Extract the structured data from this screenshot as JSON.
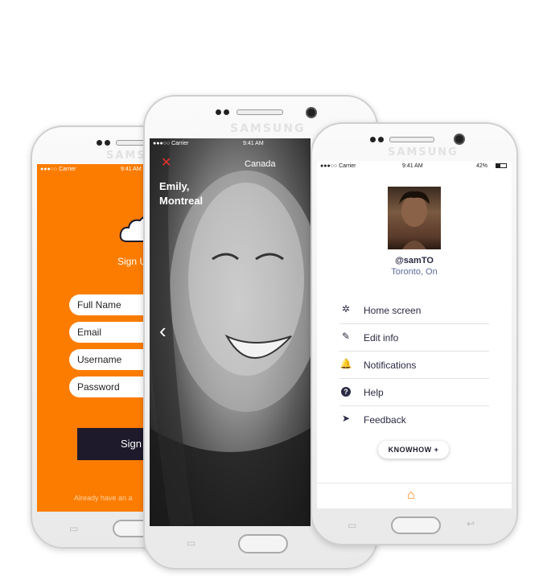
{
  "left_phone": {
    "brand": "SAMSUNG",
    "status": {
      "carrier": "●●●○○ Carrier",
      "time": "9:41 AM"
    },
    "signup_heading": "Sign U",
    "fields": [
      {
        "label": "Full Name"
      },
      {
        "label": "Email"
      },
      {
        "label": "Username"
      },
      {
        "label": "Password"
      }
    ],
    "signup_button": "Sign",
    "footer_text": "Already have an a"
  },
  "middle_phone": {
    "brand": "SAMSUNG",
    "status": {
      "carrier": "●●●○○ Carrier",
      "time": "9:41 AM"
    },
    "close_icon": "✕",
    "country": "Canada",
    "profile_name_line1": "Emily,",
    "profile_name_line2": "Montreal",
    "back_arrow": "‹"
  },
  "right_phone": {
    "brand": "SAMSUNG",
    "status": {
      "carrier": "●●●○○ Carrier",
      "time": "9:41 AM",
      "battery": "42%"
    },
    "username": "@samTO",
    "location": "Toronto, On",
    "menu": [
      {
        "icon": "network-icon",
        "glyph": "✲",
        "label": "Home screen"
      },
      {
        "icon": "edit-icon",
        "glyph": "✎",
        "label": "Edit info"
      },
      {
        "icon": "bell-icon",
        "glyph": "🔔",
        "label": "Notifications"
      },
      {
        "icon": "help-icon",
        "glyph": "?",
        "label": "Help"
      },
      {
        "icon": "paper-plane-icon",
        "glyph": "➤",
        "label": "Feedback"
      }
    ],
    "logo_text": "KNOWHOW +",
    "home_tab_glyph": "⌂"
  },
  "colors": {
    "accent": "#fc7c00",
    "dark": "#1e1a2b",
    "menu_text": "#2a2a44",
    "location_text": "#5b6a9a"
  }
}
